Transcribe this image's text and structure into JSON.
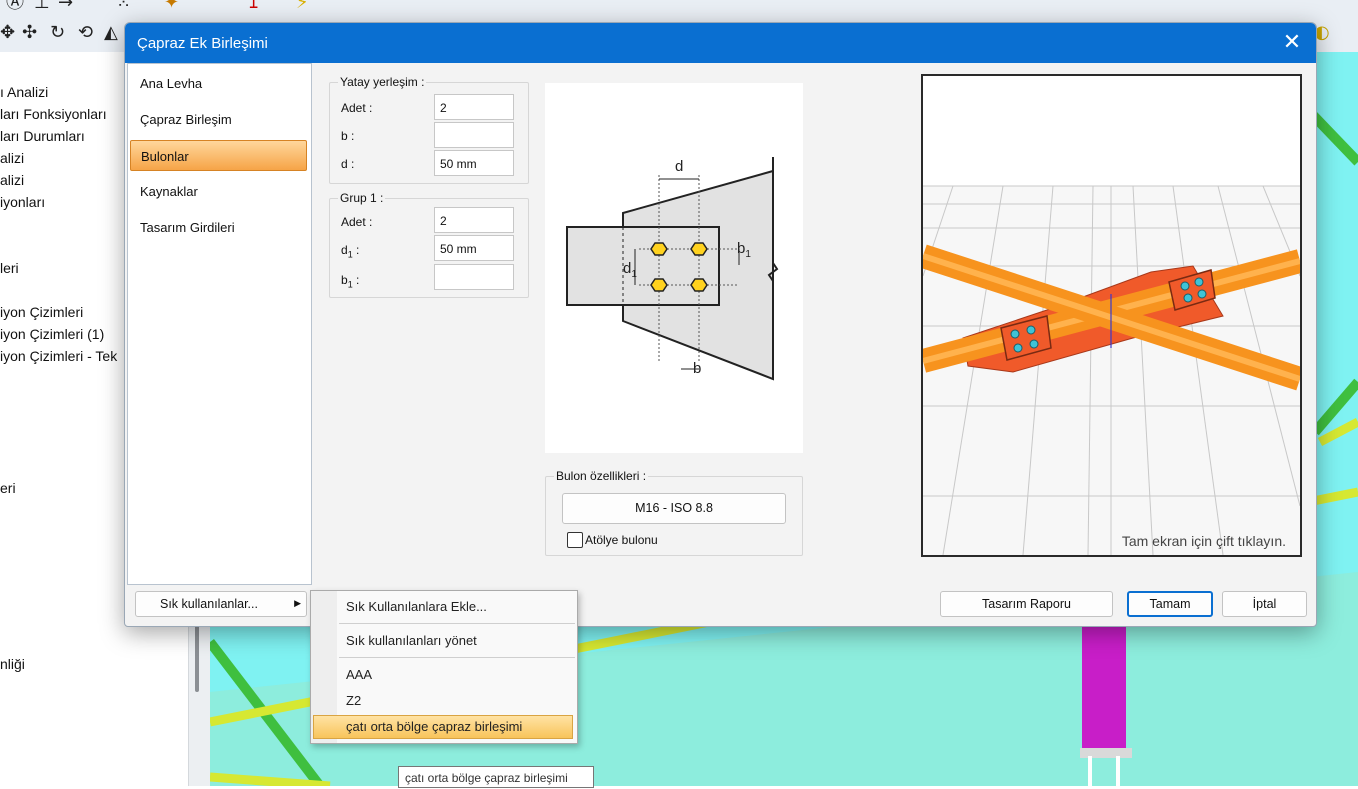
{
  "dialog": {
    "title": "Çapraz Ek Birleşimi",
    "nav_items": [
      "Ana Levha",
      "Çapraz Birleşim",
      "Bulonlar",
      "Kaynaklar",
      "Tasarım Girdileri"
    ],
    "active_nav": "Bulonlar",
    "yatay": {
      "legend": "Yatay yerleşim :",
      "adet_label": "Adet :",
      "adet_value": "2",
      "b_label": "b :",
      "b_value": "",
      "d_label": "d :",
      "d_value": "50 mm"
    },
    "grup1": {
      "legend": "Grup 1 :",
      "adet_label": "Adet :",
      "adet_value": "2",
      "d1_label": "d",
      "d1_sub": "1",
      "d1_colon": " :",
      "d1_value": "50 mm",
      "b1_label": "b",
      "b1_sub": "1",
      "b1_colon": " :",
      "b1_value": ""
    },
    "diagram_labels": {
      "d": "d",
      "b1": "b",
      "b1_sub": "1",
      "d1": "d",
      "d1_sub": "1",
      "b": "b"
    },
    "bulon": {
      "legend": "Bulon özellikleri :",
      "spec_button": "M16 - ISO 8.8",
      "atolye_label": "Atölye bulonu",
      "atolye_checked": false
    },
    "view3d_hint": "Tam ekran için çift tıklayın.",
    "footer": {
      "favorites_button": "Sık kullanılanlar...",
      "report_button": "Tasarım Raporu",
      "ok_button": "Tamam",
      "cancel_button": "İptal"
    }
  },
  "favorites_menu": {
    "items": [
      "Sık Kullanılanlara Ekle...",
      "Sık kullanılanları yönet",
      "AAA",
      "Z2",
      "çatı orta bölge çapraz birleşimi"
    ],
    "highlighted": "çatı orta bölge çapraz birleşimi"
  },
  "tooltip": "çatı orta bölge çapraz birleşimi",
  "background_tree": {
    "items": [
      "ı Analizi",
      "ları Fonksiyonları",
      "ları Durumları",
      "alizi",
      "alizi",
      "iyonları",
      "leri",
      "iyon Çizimleri",
      "iyon Çizimleri (1)",
      "iyon Çizimleri - Tek",
      "eri",
      "nliği"
    ]
  },
  "colors": {
    "title_bar": "#0a6fd1",
    "nav_active": "#f6a447",
    "beam_orange": "#f7931e",
    "plate_red": "#f05a2a",
    "bolt_cyan": "#3fc3d6",
    "viewport_cyan": "#7ff2f2"
  }
}
